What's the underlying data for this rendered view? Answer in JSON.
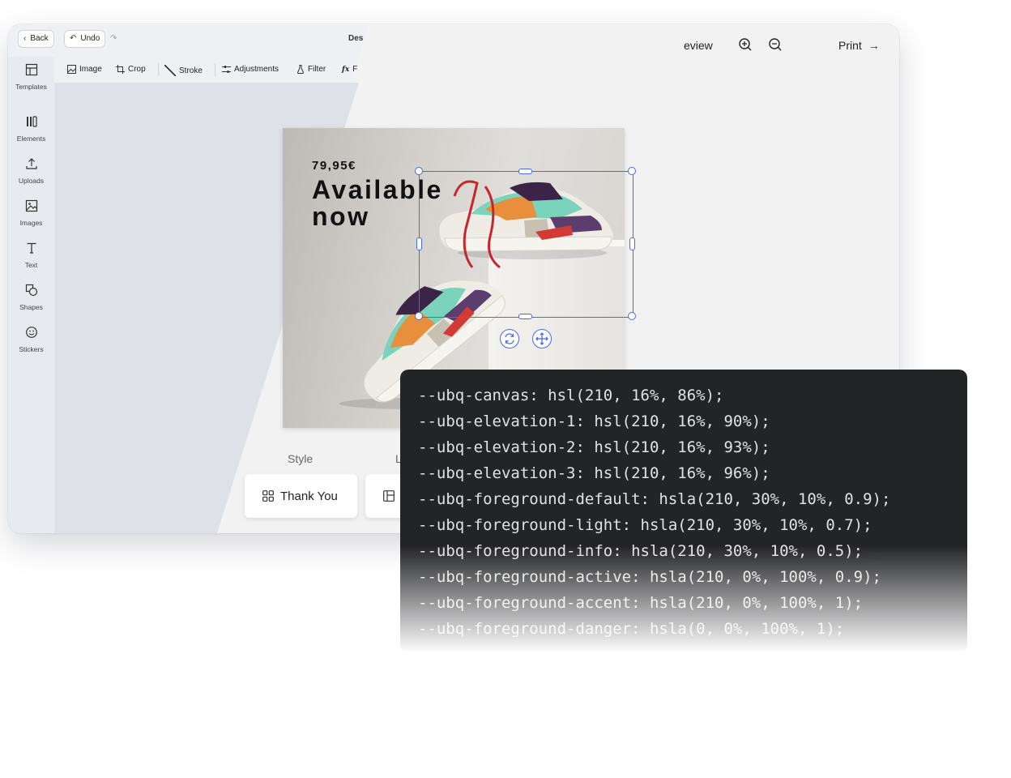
{
  "topbar": {
    "back_label": "Back",
    "undo_label": "Undo",
    "redo_glyph": "↷",
    "doc_title": "Des",
    "preview_label": "eview",
    "print_label": "Print",
    "zoom_in_icon": "zoom-in-icon",
    "zoom_out_icon": "zoom-out-icon"
  },
  "sidebar": {
    "items": [
      {
        "label": "Templates",
        "icon": "templates-icon"
      },
      {
        "label": "Elements",
        "icon": "elements-icon"
      },
      {
        "label": "Uploads",
        "icon": "upload-icon"
      },
      {
        "label": "Images",
        "icon": "image-icon"
      },
      {
        "label": "Text",
        "icon": "text-icon"
      },
      {
        "label": "Shapes",
        "icon": "shapes-icon"
      },
      {
        "label": "Stickers",
        "icon": "sticker-icon"
      }
    ]
  },
  "toolbar": {
    "items": [
      {
        "label": "Image",
        "icon": "image-icon"
      },
      {
        "label": "Crop",
        "icon": "crop-icon"
      },
      {
        "label": "Stroke",
        "icon": "stroke-icon"
      },
      {
        "label": "Adjustments",
        "icon": "adjustments-icon"
      },
      {
        "label": "Filter",
        "icon": "filter-icon"
      },
      {
        "label": "F",
        "icon": "fx-icon"
      }
    ]
  },
  "artwork": {
    "price": "79,95€",
    "headline_line1": "Available",
    "headline_line2": "now"
  },
  "style_section": {
    "label": "Style",
    "label2": "L",
    "cards": [
      {
        "label": "Thank You",
        "icon": "grid-icon"
      },
      {
        "label": "",
        "icon": "layout-icon"
      }
    ]
  },
  "code_panel": {
    "lines": [
      "--ubq-canvas: hsl(210, 16%, 86%);",
      "--ubq-elevation-1: hsl(210, 16%, 90%);",
      "--ubq-elevation-2: hsl(210, 16%, 93%);",
      "--ubq-elevation-3: hsl(210, 16%, 96%);",
      "--ubq-foreground-default: hsla(210, 30%, 10%, 0.9);",
      "--ubq-foreground-light: hsla(210, 30%, 10%, 0.7);",
      "--ubq-foreground-info: hsla(210, 30%, 10%, 0.5);",
      "--ubq-foreground-active: hsla(210, 0%, 100%, 0.9);",
      "--ubq-foreground-accent: hsla(210, 0%, 100%, 1);",
      "--ubq-foreground-danger: hsla(0, 0%, 100%, 1);"
    ]
  },
  "colors": {
    "selection": "#4b69e0",
    "code_bg": "#232426",
    "canvas": "#dee2e8"
  }
}
